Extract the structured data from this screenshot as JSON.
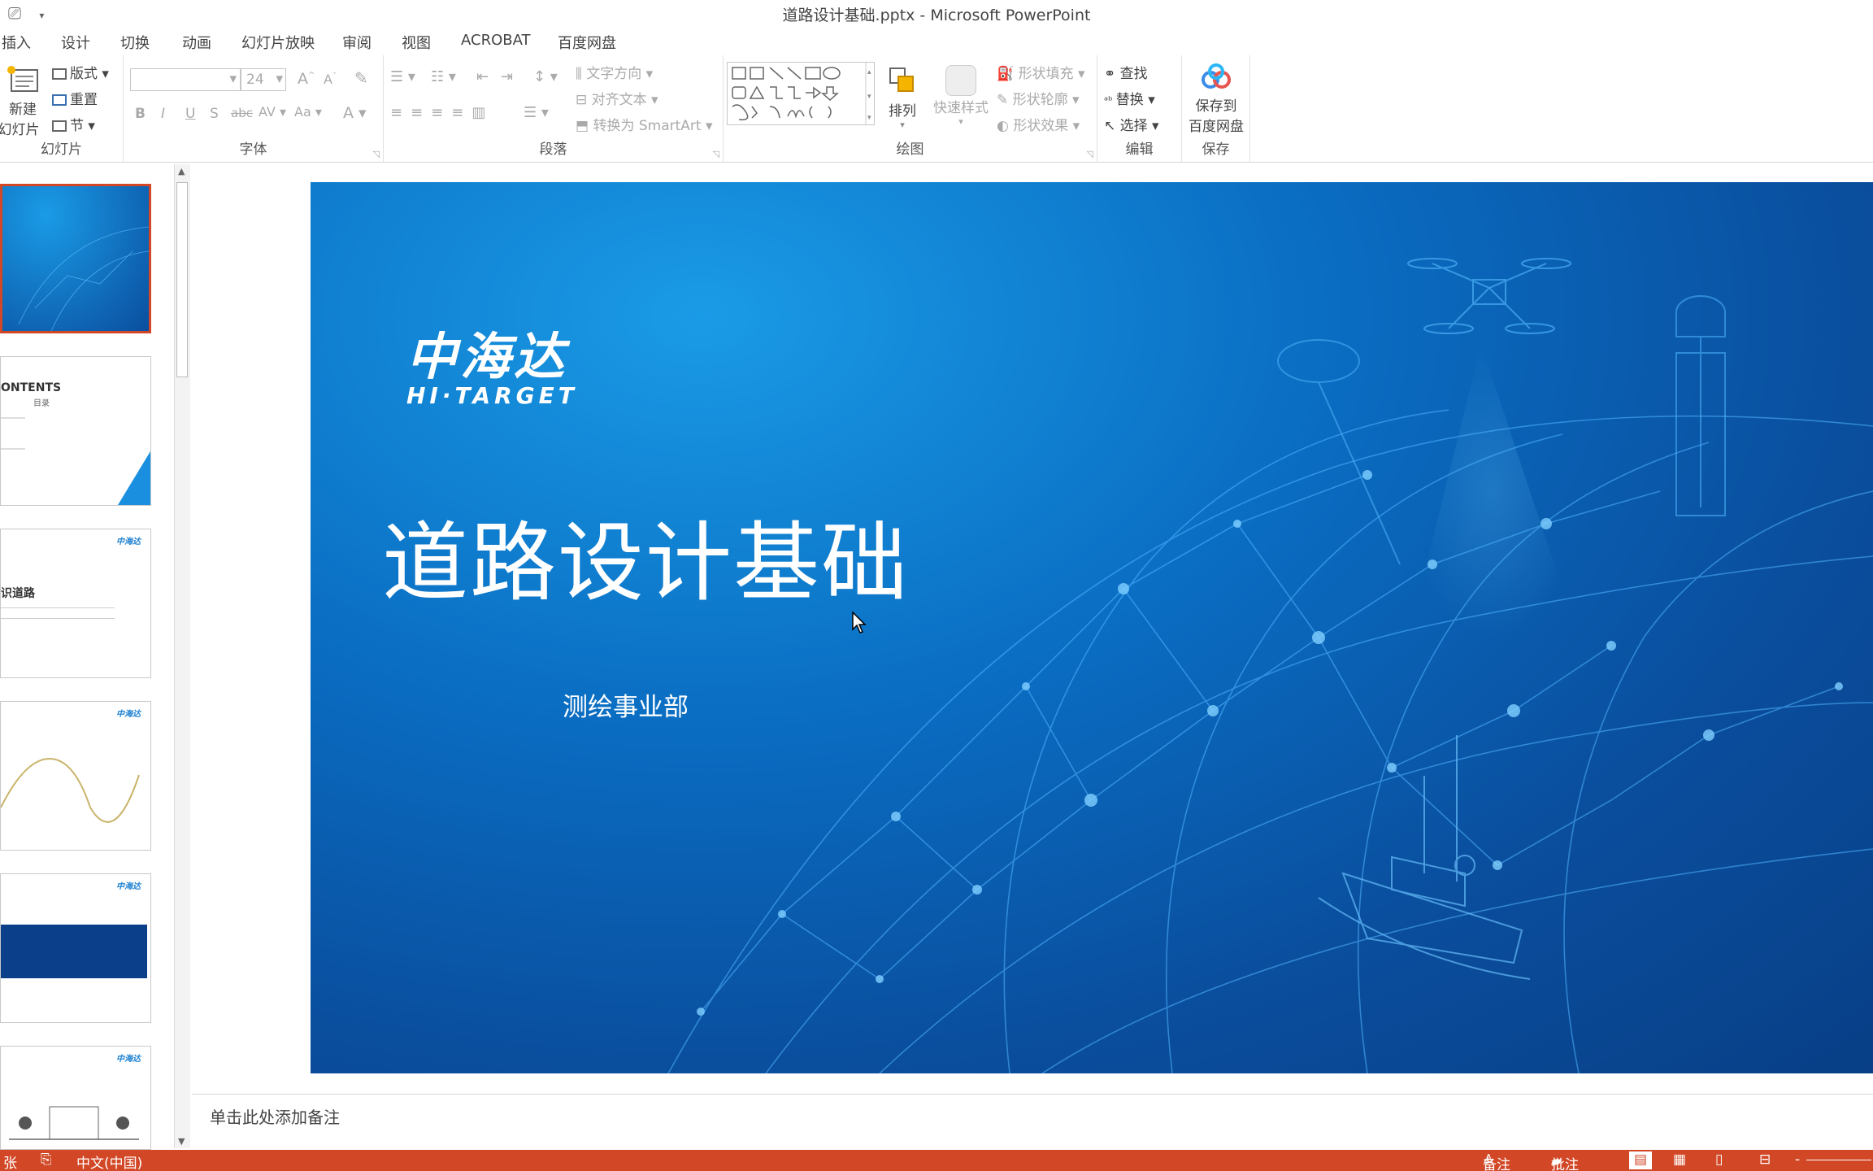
{
  "window": {
    "title": "道路设计基础.pptx - Microsoft PowerPoint"
  },
  "menu": {
    "tabs": [
      "插入",
      "设计",
      "切换",
      "动画",
      "幻灯片放映",
      "审阅",
      "视图",
      "ACROBAT",
      "百度网盘"
    ]
  },
  "ribbon": {
    "slides": {
      "new_label_1": "新建",
      "new_label_2": "幻灯片",
      "layout": "版式",
      "reset": "重置",
      "section": "节",
      "group": "幻灯片"
    },
    "font": {
      "size": "24",
      "bold": "B",
      "italic": "I",
      "underline": "U",
      "shadow": "S",
      "strike": "abc",
      "spacing": "AV",
      "case": "Aa",
      "color": "A",
      "group": "字体"
    },
    "paragraph": {
      "text_direction": "文字方向",
      "align_text": "对齐文本",
      "smartart": "转换为 SmartArt",
      "group": "段落"
    },
    "drawing": {
      "arrange": "排列",
      "quick_styles": "快速样式",
      "fill": "形状填充",
      "outline": "形状轮廓",
      "effects": "形状效果",
      "group": "绘图"
    },
    "editing": {
      "find": "查找",
      "replace": "替换",
      "select": "选择",
      "group": "编辑"
    },
    "save": {
      "label_1": "保存到",
      "label_2": "百度网盘",
      "group": "保存"
    }
  },
  "slide": {
    "logo_cn": "中海达",
    "logo_en": "HI·TARGET",
    "title": "道路设计基础",
    "subtitle": "测绘事业部"
  },
  "thumbnails": {
    "t2_heading": "ONTENTS",
    "t2_sub": "目录",
    "t3_heading": "识道路",
    "logo_small": "中海达"
  },
  "notes": {
    "placeholder": "单击此处添加备注"
  },
  "status": {
    "slide_info": "张",
    "language": "中文(中国)",
    "notes_btn": "备注",
    "comments_btn": "批注"
  },
  "colors": {
    "accent": "#d24726",
    "slide_blue": "#0a6dc2"
  }
}
